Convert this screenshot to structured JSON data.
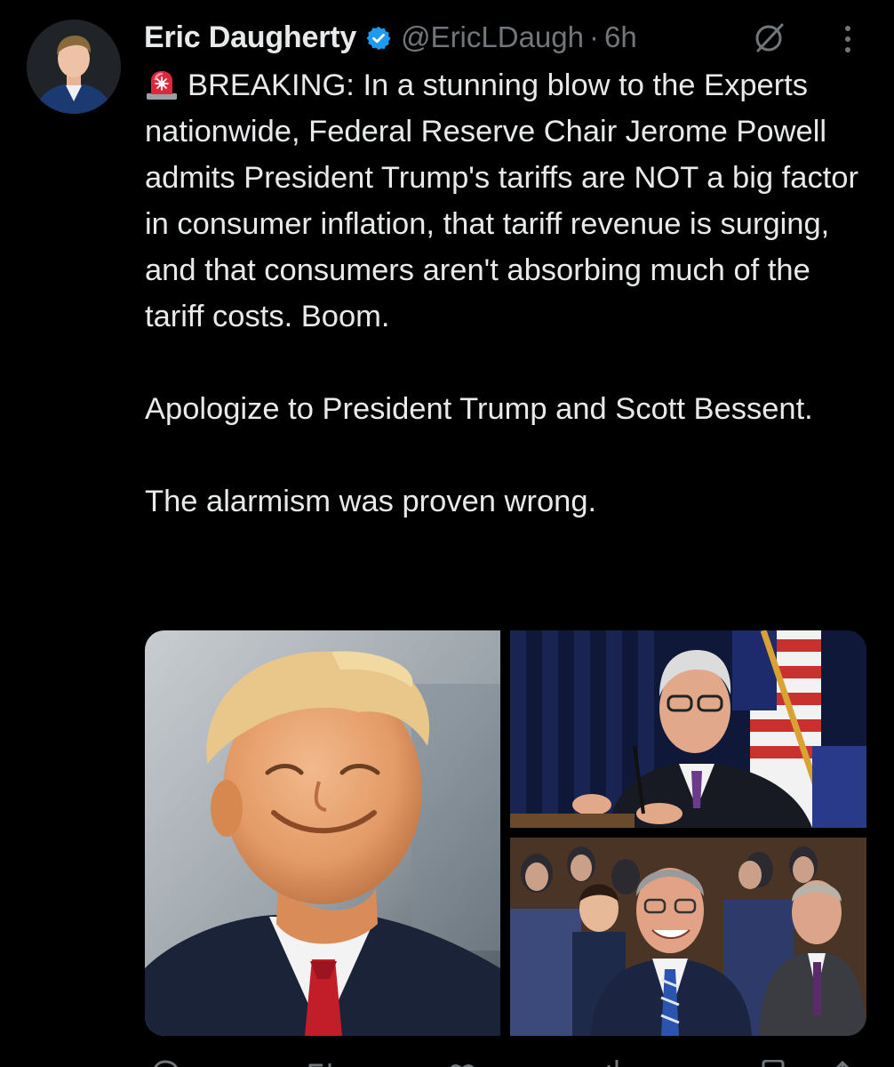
{
  "author": {
    "display_name": "Eric Daugherty",
    "handle": "@EricLDaugh",
    "separator": "·",
    "time": "6h",
    "verified": true,
    "accent_color": "#1d9bf0"
  },
  "tweet": {
    "emoji": "siren-emoji",
    "paragraph_1": "BREAKING: In a stunning blow to the Experts nationwide, Federal Reserve Chair Jerome Powell admits President Trump's tariffs are NOT a big factor in consumer inflation, that tariff revenue is surging, and that consumers aren't absorbing much of the tariff costs. Boom.",
    "paragraph_2": "Apologize to President Trump and Scott Bessent.",
    "paragraph_3": "The alarmism was proven wrong."
  },
  "media": {
    "count": 3,
    "items": [
      "smiling-man-photo",
      "speaker-at-podium-photo",
      "seated-hearing-photo"
    ]
  },
  "icons": {
    "verified": "verified-badge-icon",
    "grok": "grok-icon",
    "more": "more-options-icon",
    "reply": "reply-icon",
    "retweet": "retweet-icon",
    "like": "like-icon",
    "views": "views-icon",
    "bookmark": "bookmark-icon",
    "share": "share-icon"
  },
  "colors": {
    "background": "#000000",
    "text": "#e7e9ea",
    "muted": "#71767b"
  }
}
